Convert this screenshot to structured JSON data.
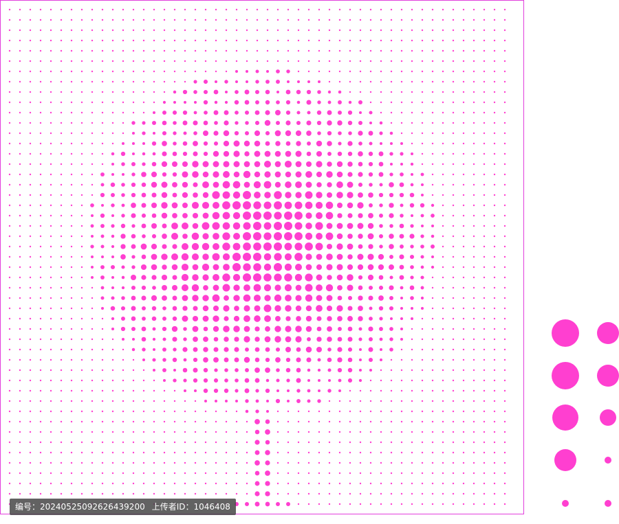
{
  "colors": {
    "dot": "#ff3fd0",
    "frame": "#e23ddc",
    "background": "#ffffff"
  },
  "artwork": {
    "subject": "halftone tree",
    "dot_shape": "circle"
  },
  "watermark": {
    "id_label": "编号：",
    "id_value": "20240525092626439200",
    "uploader_label": "上传者ID：",
    "uploader_value": "1046408"
  }
}
